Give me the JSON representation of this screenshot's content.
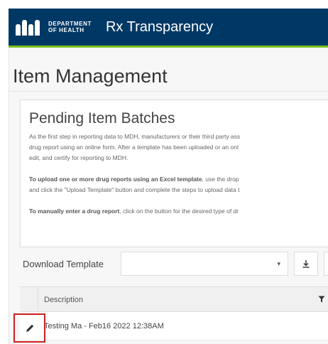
{
  "header": {
    "logo_line1": "DEPARTMENT",
    "logo_line2": "OF HEALTH",
    "app_title": "Rx Transparency"
  },
  "page": {
    "title": "Item Management"
  },
  "card": {
    "title": "Pending Item Batches",
    "p1_line1": "As the first step in reporting data to MDH, manufacturers or their third party ass",
    "p1_line2": "drug report using an online form. After a template has been uploaded or an onl",
    "p1_line3": "edit, and certify for reporting to MDH.",
    "p2_bold": "To upload one or more drug reports using an Excel template",
    "p2_line1_rest": ", use the drop",
    "p2_line2": "and click the \"Upload Template\" button and complete the steps to upload data t",
    "p3_bold": "To manually enter a drug report",
    "p3_rest": ", click on the button for the desired type of dr"
  },
  "download": {
    "label": "Download Template",
    "caret": "▾",
    "button_icon": "download-icon"
  },
  "grid": {
    "column_description": "Description",
    "filter_icon": "filter-icon",
    "rows": [
      {
        "description": "Testing Ma - Feb16 2022 12:38AM",
        "edit_icon": "pencil-icon"
      }
    ]
  },
  "colors": {
    "navbar": "#003865",
    "accent_green": "#78be20",
    "highlight_red": "#cc1f1f"
  }
}
